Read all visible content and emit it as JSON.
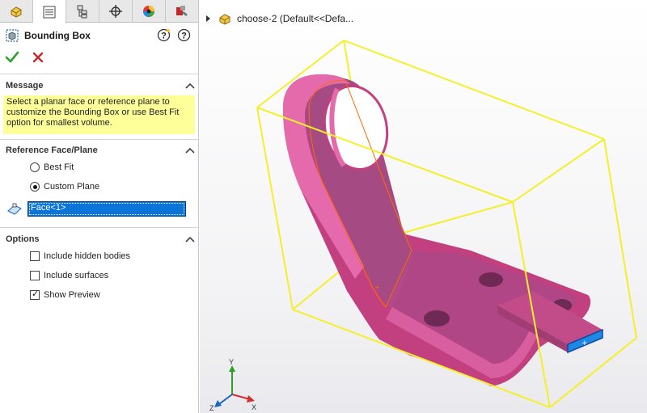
{
  "tabs": [
    {
      "name": "feature-manager",
      "icon": "part-icon"
    },
    {
      "name": "property-manager",
      "icon": "property-manager-icon",
      "active": true
    },
    {
      "name": "configuration-manager",
      "icon": "configuration-icon"
    },
    {
      "name": "dimxpert-manager",
      "icon": "crosshair-icon"
    },
    {
      "name": "display-manager",
      "icon": "appearance-icon"
    },
    {
      "name": "cam-manager",
      "icon": "cam-icon"
    }
  ],
  "property_manager": {
    "title": "Bounding Box",
    "message_section": {
      "heading": "Message",
      "text": "Select a planar face or reference plane to customize the Bounding Box or use Best Fit option for smallest volume."
    },
    "reference_section": {
      "heading": "Reference Face/Plane",
      "options": [
        {
          "label": "Best Fit",
          "selected": false
        },
        {
          "label": "Custom Plane",
          "selected": true
        }
      ],
      "selection_value": "Face<1>"
    },
    "options_section": {
      "heading": "Options",
      "checkboxes": [
        {
          "label": "Include hidden bodies",
          "checked": false
        },
        {
          "label": "Include surfaces",
          "checked": false
        },
        {
          "label": "Show Preview",
          "checked": true
        }
      ]
    }
  },
  "viewport": {
    "tree_item": "choose-2  (Default<<Defa...",
    "triad_axes": [
      "Y",
      "Z",
      "X"
    ]
  },
  "colors": {
    "accent_blue": "#0a74d9",
    "message_bg": "#ffff99",
    "part_pink": "#d9559c",
    "bbox_yellow": "#f5ef2a",
    "ok_green": "#2e9e2e",
    "cancel_red": "#c62828"
  }
}
